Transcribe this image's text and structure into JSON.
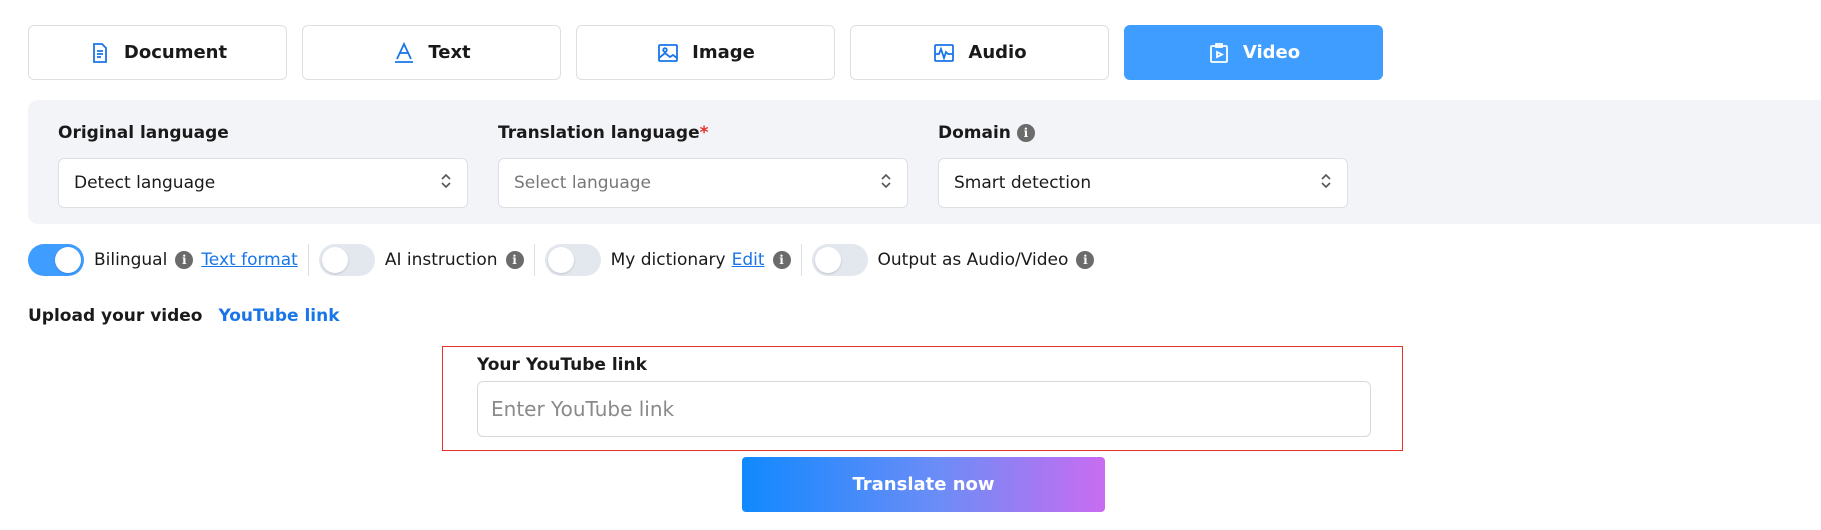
{
  "tabs": [
    {
      "label": "Document",
      "icon": "document-icon",
      "active": false
    },
    {
      "label": "Text",
      "icon": "text-icon",
      "active": false
    },
    {
      "label": "Image",
      "icon": "image-icon",
      "active": false
    },
    {
      "label": "Audio",
      "icon": "audio-icon",
      "active": false
    },
    {
      "label": "Video",
      "icon": "video-icon",
      "active": true
    }
  ],
  "settings": {
    "original_language": {
      "label": "Original language",
      "value": "Detect language"
    },
    "translation_language": {
      "label": "Translation language",
      "required_mark": "*",
      "placeholder": "Select language"
    },
    "domain": {
      "label": "Domain",
      "value": "Smart detection"
    }
  },
  "options": {
    "bilingual": {
      "label": "Bilingual",
      "on": true,
      "link": "Text format"
    },
    "ai_instruction": {
      "label": "AI instruction",
      "on": false
    },
    "my_dictionary": {
      "label": "My dictionary",
      "on": false,
      "link": "Edit"
    },
    "output_av": {
      "label": "Output as Audio/Video",
      "on": false
    }
  },
  "upload": {
    "title": "Upload your video",
    "youtube_tab": "YouTube link",
    "field_label": "Your YouTube link",
    "placeholder": "Enter YouTube link"
  },
  "translate_button": "Translate now",
  "colors": {
    "accent": "#3e9dff",
    "link": "#1976e8",
    "highlight_border": "#e5322d",
    "button_gradient_start": "#1189ff",
    "button_gradient_end": "#c96cf1"
  }
}
